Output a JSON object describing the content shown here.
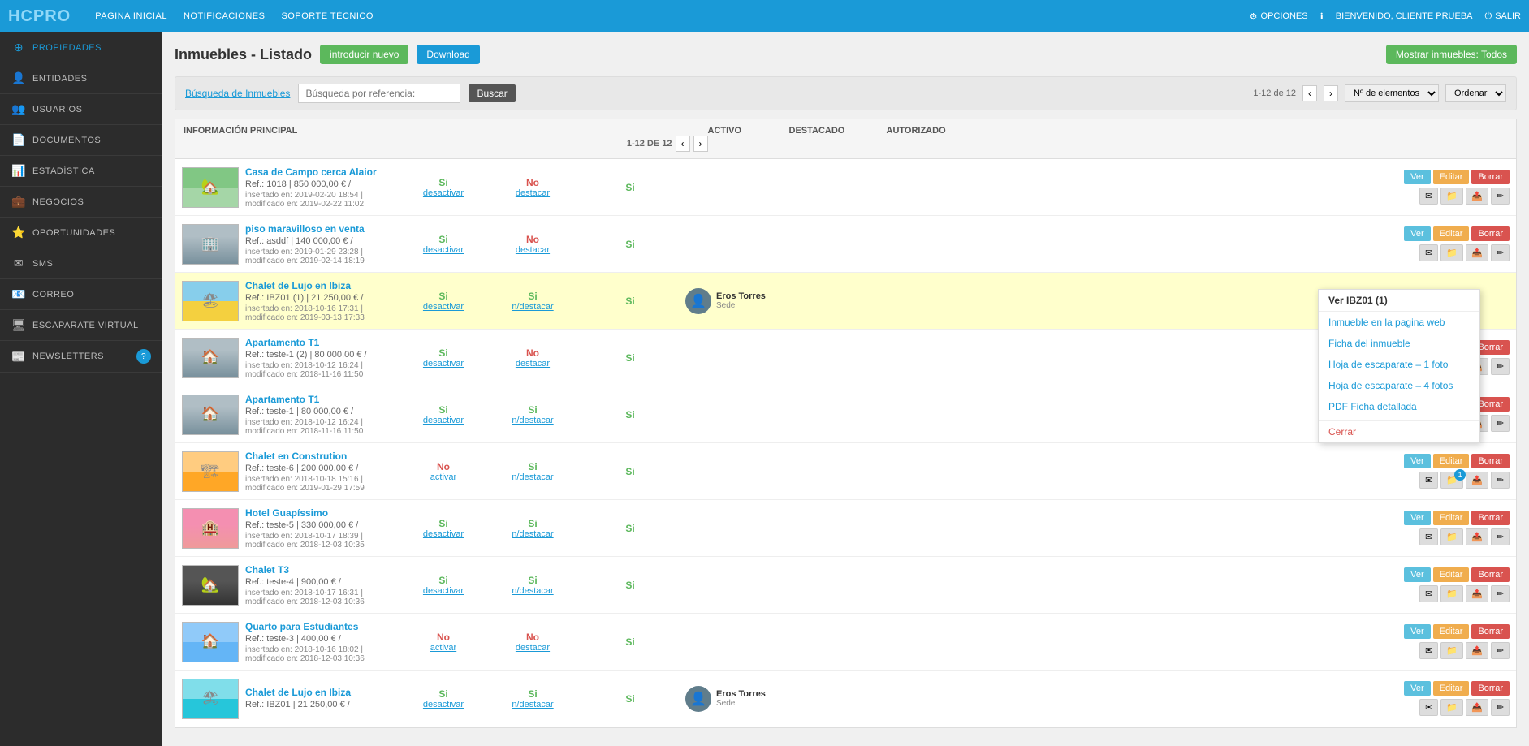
{
  "topNav": {
    "logo": "HCPRO",
    "links": [
      "PAGINA INICIAL",
      "NOTIFICACIONES",
      "SOPORTE TÉCNICO"
    ],
    "optionsLabel": "OPCIONES",
    "infoIcon": "ℹ",
    "welcomeLabel": "BIENVENIDO, CLIENTE PRUEBA",
    "salirLabel": "SALIR"
  },
  "sidebar": {
    "items": [
      {
        "label": "PROPIEDADES",
        "icon": "⊕",
        "active": true
      },
      {
        "label": "ENTIDADES",
        "icon": "👤"
      },
      {
        "label": "USUARIOS",
        "icon": "👥"
      },
      {
        "label": "DOCUMENTOS",
        "icon": "📄"
      },
      {
        "label": "ESTADÍSTICA",
        "icon": "📊"
      },
      {
        "label": "NEGOCIOS",
        "icon": "💼"
      },
      {
        "label": "OPORTUNIDADES",
        "icon": "⭐"
      },
      {
        "label": "SMS",
        "icon": "✉"
      },
      {
        "label": "CORREO",
        "icon": "📧"
      },
      {
        "label": "ESCAPARATE VIRTUAL",
        "icon": "🖥"
      },
      {
        "label": "NEWSLETTERS",
        "icon": "📰",
        "badge": "?"
      }
    ]
  },
  "pageHeader": {
    "title": "Inmuebles - Listado",
    "btnNuevo": "introducir nuevo",
    "btnDownload": "Download",
    "btnMostrar": "Mostrar inmuebles: Todos"
  },
  "searchBar": {
    "linkLabel": "Búsqueda de Inmuebles",
    "inputPlaceholder": "Búsqueda por referencia:",
    "btnBuscar": "Buscar",
    "pagination": "1-12 de 12",
    "selectElements": "Nº de elementos",
    "selectOrder": "Ordenar"
  },
  "tableHeader": {
    "colInfo": "INFORMACIÓN PRINCIPAL",
    "colActivo": "ACTIVO",
    "colDestacado": "DESTACADO",
    "colAutorizado": "AUTORIZADO",
    "rowCount": "1-12 de 12"
  },
  "properties": [
    {
      "id": 1,
      "name": "Casa de Campo cerca Alaior",
      "ref": "Ref.: 1018 | 850 000,00 € /",
      "date": "insertado en: 2019-02-20 18:54 | modificado en: 2019-02-22 11:02",
      "activo": "Si",
      "activoLink": "desactivar",
      "destacado": "No",
      "destacadoLink": "destacar",
      "autorizado": "Si",
      "agent": null,
      "thumbClass": "rural",
      "highlighted": false,
      "hasBadge": false
    },
    {
      "id": 2,
      "name": "piso maravilloso en venta",
      "ref": "Ref.: asddf | 140 000,00 € /",
      "date": "insertado en: 2019-01-29 23:28 | modificado en: 2019-02-14 18:19",
      "activo": "Si",
      "activoLink": "desactivar",
      "destacado": "No",
      "destacadoLink": "destacar",
      "autorizado": "Si",
      "agent": null,
      "thumbClass": "apt",
      "highlighted": false,
      "hasBadge": false
    },
    {
      "id": 3,
      "name": "Chalet de Lujo en Ibiza",
      "ref": "Ref.: IBZ01 (1) | 21 250,00 € /",
      "date": "insertado en: 2018-10-16 17:31 | modificado en: 2019-03-13 17:33",
      "activo": "Si",
      "activoLink": "desactivar",
      "destacado": "Si",
      "destacadoLink": "n/destacar",
      "autorizado": "Si",
      "agent": {
        "name": "Eros Torres",
        "role": "Sede"
      },
      "thumbClass": "beach",
      "highlighted": true,
      "hasBadge": false,
      "showDropdown": true
    },
    {
      "id": 4,
      "name": "Apartamento T1",
      "ref": "Ref.: teste-1 (2) | 80 000,00 € /",
      "date": "insertado en: 2018-10-12 16:24 | modificado en: 2018-11-16 11:50",
      "activo": "Si",
      "activoLink": "desactivar",
      "destacado": "No",
      "destacadoLink": "destacar",
      "autorizado": "Si",
      "agent": null,
      "thumbClass": "apt",
      "highlighted": false,
      "hasBadge": false
    },
    {
      "id": 5,
      "name": "Apartamento T1",
      "ref": "Ref.: teste-1 | 80 000,00 € /",
      "date": "insertado en: 2018-10-12 16:24 | modificado en: 2018-11-16 11:50",
      "activo": "Si",
      "activoLink": "desactivar",
      "destacado": "Si",
      "destacadoLink": "n/destacar",
      "autorizado": "Si",
      "agent": null,
      "thumbClass": "apt",
      "highlighted": false,
      "hasBadge": false
    },
    {
      "id": 6,
      "name": "Chalet en Constrution",
      "ref": "Ref.: teste-6 | 200 000,00 € /",
      "date": "insertado en: 2018-10-18 15:16 | modificado en: 2019-01-29 17:59",
      "activo": "No",
      "activoLink": "activar",
      "destacado": "Si",
      "destacadoLink": "n/destacar",
      "autorizado": "Si",
      "agent": null,
      "thumbClass": "construction",
      "highlighted": false,
      "hasBadge": true
    },
    {
      "id": 7,
      "name": "Hotel Guapíssimo",
      "ref": "Ref.: teste-5 | 330 000,00 € /",
      "date": "insertado en: 2018-10-17 18:39 | modificado en: 2018-12-03 10:35",
      "activo": "Si",
      "activoLink": "desactivar",
      "destacado": "Si",
      "destacadoLink": "n/destacar",
      "autorizado": "Si",
      "agent": null,
      "thumbClass": "hotel",
      "highlighted": false,
      "hasBadge": false
    },
    {
      "id": 8,
      "name": "Chalet T3",
      "ref": "Ref.: teste-4 | 900,00 € /",
      "date": "insertado en: 2018-10-17 16:31 | modificado en: 2018-12-03 10:36",
      "activo": "Si",
      "activoLink": "desactivar",
      "destacado": "Si",
      "destacadoLink": "n/destacar",
      "autorizado": "Si",
      "agent": null,
      "thumbClass": "dark",
      "highlighted": false,
      "hasBadge": false
    },
    {
      "id": 9,
      "name": "Quarto para Estudiantes",
      "ref": "Ref.: teste-3 | 400,00 € /",
      "date": "insertado en: 2018-10-16 18:02 | modificado en: 2018-12-03 10:36",
      "activo": "No",
      "activoLink": "activar",
      "destacado": "No",
      "destacadoLink": "destacar",
      "autorizado": "Si",
      "agent": null,
      "thumbClass": "students",
      "highlighted": false,
      "hasBadge": false
    },
    {
      "id": 10,
      "name": "Chalet de Lujo en Ibiza",
      "ref": "Ref.: IBZ01 | 21 250,00 € /",
      "date": "",
      "activo": "Si",
      "activoLink": "desactivar",
      "destacado": "Si",
      "destacadoLink": "n/destacar",
      "autorizado": "Si",
      "agent": {
        "name": "Eros Torres",
        "role": "Sede"
      },
      "thumbClass": "ibiza2",
      "highlighted": false,
      "hasBadge": false
    }
  ],
  "dropdown": {
    "header": "Ver IBZ01 (1)",
    "items": [
      {
        "label": "Inmueble en la pagina web",
        "style": "link"
      },
      {
        "label": "Ficha del inmueble",
        "style": "link"
      },
      {
        "label": "Hoja de escaparate – 1 foto",
        "style": "link"
      },
      {
        "label": "Hoja de escaparate – 4 fotos",
        "style": "link"
      },
      {
        "label": "PDF Ficha detallada",
        "style": "link"
      },
      {
        "label": "Cerrar",
        "style": "close"
      }
    ]
  },
  "buttons": {
    "ver": "Ver",
    "editar": "Editar",
    "borrar": "Borrar"
  }
}
